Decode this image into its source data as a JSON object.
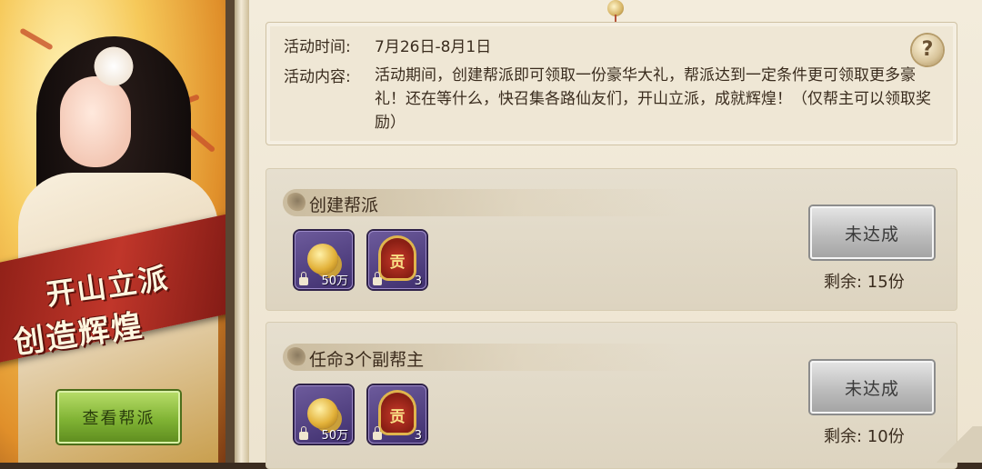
{
  "banner": {
    "slogan_line1": "开山立派",
    "slogan_line2": "创造辉煌",
    "view_button": "查看帮派"
  },
  "info": {
    "time_label": "活动时间:",
    "time_value": "7月26日-8月1日",
    "content_label": "活动内容:",
    "content_value": "活动期间，创建帮派即可领取一份豪华大礼，帮派达到一定条件更可领取更多豪礼！还在等什么，快召集各路仙友们，开山立派，成就辉煌！（仅帮主可以领取奖励）",
    "help_icon": "?"
  },
  "tasks": [
    {
      "title": "创建帮派",
      "rewards": [
        {
          "icon": "coin-stack-icon",
          "qty": "50万"
        },
        {
          "icon": "contribution-badge-icon",
          "glyph": "贡",
          "qty": "3"
        }
      ],
      "status_button": "未达成",
      "remain": "剩余:  15份"
    },
    {
      "title": "任命3个副帮主",
      "rewards": [
        {
          "icon": "coin-stack-icon",
          "qty": "50万"
        },
        {
          "icon": "contribution-badge-icon",
          "glyph": "贡",
          "qty": "3"
        }
      ],
      "status_button": "未达成",
      "remain": "剩余:  10份"
    }
  ],
  "colors": {
    "paper": "#efe7d5",
    "green_button": "#80b334",
    "grey_button": "#bdbdbd",
    "item_bg": "#4f3f82",
    "ribbon": "#c0362a"
  }
}
